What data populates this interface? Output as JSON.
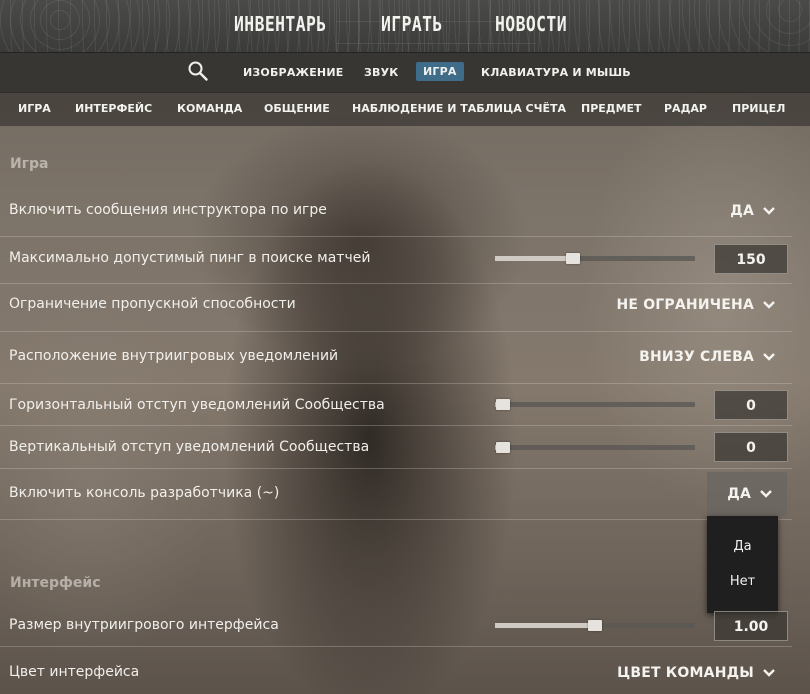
{
  "top_nav": [
    "ИНВЕНТАРЬ",
    "ИГРАТЬ",
    "НОВОСТИ"
  ],
  "settings_nav": {
    "items": [
      "ИЗОБРАЖЕНИЕ",
      "ЗВУК",
      "ИГРА",
      "КЛАВИАТУРА И МЫШЬ"
    ],
    "active": "ИГРА"
  },
  "tabs": [
    "ИГРА",
    "ИНТЕРФЕЙС",
    "КОМАНДА",
    "ОБЩЕНИЕ",
    "НАБЛЮДЕНИЕ И ТАБЛИЦА СЧЁТА",
    "ПРЕДМЕТ",
    "РАДАР",
    "ПРИЦЕЛ"
  ],
  "sections": {
    "game": {
      "title": "Игра",
      "rows": [
        {
          "label": "Включить сообщения инструктора по игре",
          "type": "dropdown",
          "value": "ДА"
        },
        {
          "label": "Максимально допустимый пинг в поиске матчей",
          "type": "slider",
          "value": "150",
          "fraction": 0.39
        },
        {
          "label": "Ограничение пропускной способности",
          "type": "dropdown",
          "value": "НЕ ОГРАНИЧЕНА"
        },
        {
          "label": "Расположение внутриигровых уведомлений",
          "type": "dropdown",
          "value": "ВНИЗУ СЛЕВА"
        },
        {
          "label": "Горизонтальный отступ уведомлений Сообщества",
          "type": "slider",
          "value": "0",
          "fraction": 0.04
        },
        {
          "label": "Вертикальный отступ уведомлений Сообщества",
          "type": "slider",
          "value": "0",
          "fraction": 0.04
        },
        {
          "label": "Включить консоль разработчика (~)",
          "type": "dropdown",
          "value": "ДА",
          "open": true
        }
      ]
    },
    "interface": {
      "title": "Интерфейс",
      "rows": [
        {
          "label": "Размер внутриигрового интерфейса",
          "type": "slider",
          "value": "1.00",
          "fraction": 0.5
        },
        {
          "label": "Цвет интерфейса",
          "type": "dropdown",
          "value": "ЦВЕТ КОМАНДЫ"
        }
      ]
    }
  },
  "console_menu": [
    "Да",
    "Нет"
  ],
  "colors": {
    "accent": "#3f6c88",
    "menu_bg": "#1f1f1f"
  },
  "icons": {
    "search": "search-icon",
    "chevron": "chevron-down-icon"
  }
}
